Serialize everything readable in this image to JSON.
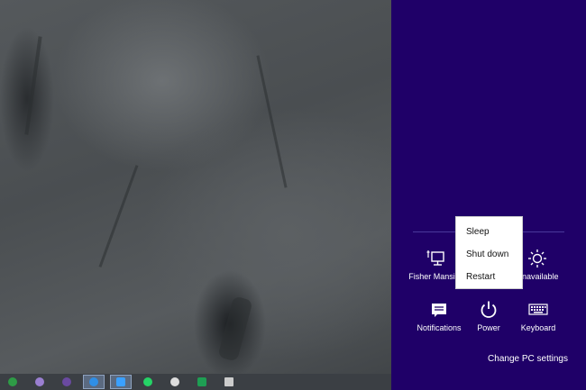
{
  "charm": {
    "tiles": [
      {
        "label": "Fisher Mansion",
        "icon": "network-icon"
      },
      {
        "label": "Unavailable",
        "icon": "brightness-icon"
      },
      {
        "label": "Notifications",
        "icon": "notifications-icon"
      },
      {
        "label": "Power",
        "icon": "power-icon"
      },
      {
        "label": "Keyboard",
        "icon": "keyboard-icon"
      }
    ],
    "change_settings": "Change PC settings"
  },
  "power_menu": {
    "items": [
      "Sleep",
      "Shut down",
      "Restart"
    ]
  },
  "taskbar": {
    "items": [
      {
        "icon": "green-app-icon",
        "color": "#2e9b46"
      },
      {
        "icon": "visual-studio-icon",
        "color": "#9a7fd1"
      },
      {
        "icon": "purple-app-icon",
        "color": "#6a4aa0"
      },
      {
        "icon": "messenger-icon",
        "color": "#2f8fe6"
      },
      {
        "icon": "chat-app-icon",
        "color": "#3aa0ff"
      },
      {
        "icon": "whatsapp-icon",
        "color": "#25d366"
      },
      {
        "icon": "chrome-icon",
        "color": "#dddddd"
      },
      {
        "icon": "sheets-icon",
        "color": "#1e9e53"
      },
      {
        "icon": "notepad-icon",
        "color": "#cccccc"
      }
    ]
  },
  "colors": {
    "charm_background": "#1f0068",
    "menu_background": "#ffffff"
  }
}
